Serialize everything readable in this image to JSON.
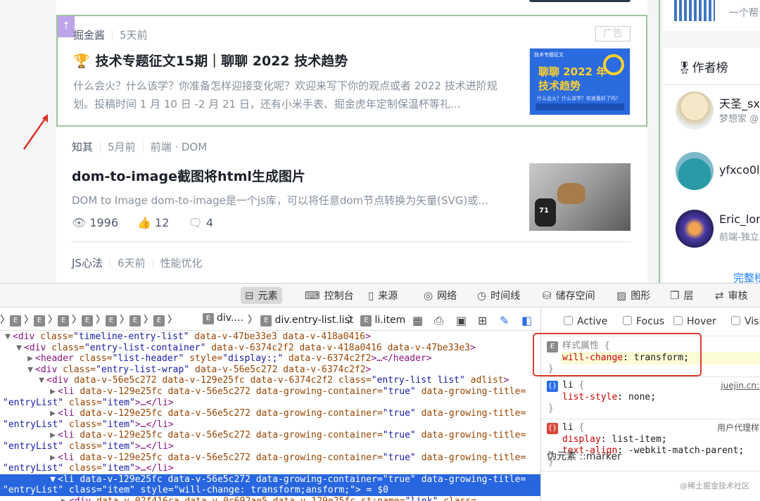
{
  "feed": {
    "ad_entry": {
      "corner_label": "↑",
      "author": "掘金酱",
      "time": "5天前",
      "badge": "广告",
      "title_icon": "trophy-icon",
      "title": "技术专题征文15期｜聊聊 2022 技术趋势",
      "abstract": "什么会火？什么该学？你准备怎样迎接变化呢？欢迎来写下你的观点或者 2022 技术进阶规划。投稿时间 1 月 10 日 -2 月 21 日，还有小米手表、掘金虎年定制保温杯等礼…",
      "thumb": {
        "top_text": "技术专题征文",
        "line1": "聊聊 2022 年",
        "line2": "技术趋势",
        "sub": "什么会火？什么该学？你准备好了吗？"
      }
    },
    "entry2": {
      "author": "知其",
      "time": "5月前",
      "tags": "前端 · DOM",
      "title": "dom-to-image截图将html生成图片",
      "abstract": "DOM to Image dom-to-image是一个js库，可以将任意dom节点转换为矢量(SVG)或…",
      "thumb_number": "71",
      "views": "1996",
      "likes": "12",
      "comments": "4"
    },
    "entry3": {
      "author": "JS心法",
      "time": "6天前",
      "tags": "性能优化"
    }
  },
  "sidebar": {
    "top_text": "一个帮",
    "authors_title": "作者榜",
    "authors": [
      {
        "name": "天圣_sx",
        "desc": "梦想家 @"
      },
      {
        "name": "yfxco0l",
        "desc": ""
      },
      {
        "name": "Eric_lor",
        "desc": "前端-独立"
      }
    ],
    "more": "完整榜"
  },
  "devtools": {
    "tabs": [
      {
        "icon": "elements-icon",
        "label": "元素"
      },
      {
        "icon": "console-icon",
        "label": "控制台"
      },
      {
        "icon": "sources-icon",
        "label": "来源"
      },
      {
        "icon": "network-icon",
        "label": "网络"
      },
      {
        "icon": "timeline-icon",
        "label": "时间线"
      },
      {
        "icon": "storage-icon",
        "label": "储存空间"
      },
      {
        "icon": "graphics-icon",
        "label": "图形"
      },
      {
        "icon": "layers-icon",
        "label": "层"
      },
      {
        "icon": "audit-icon",
        "label": "审核"
      }
    ],
    "breadcrumb": {
      "item1": "div....",
      "item2": "div.entry-list.list",
      "item3": "li.item"
    },
    "dom_lines": [
      {
        "tw": "▼",
        "indent": 0,
        "parts": [
          [
            "tg",
            "<div "
          ],
          [
            "an",
            "class="
          ],
          [
            "av",
            "\"timeline-entry-list\""
          ],
          [
            "an",
            " data-v-47be33e3 data-v-418a0416"
          ],
          [
            "tg",
            ">"
          ]
        ]
      },
      {
        "tw": "▼",
        "indent": 1,
        "parts": [
          [
            "tg",
            "<div "
          ],
          [
            "an",
            "class="
          ],
          [
            "av",
            "\"entry-list-container\""
          ],
          [
            "an",
            " data-v-6374c2f2 data-v-418a0416 data-v-47be33e3"
          ],
          [
            "tg",
            ">"
          ]
        ]
      },
      {
        "tw": "▶",
        "indent": 2,
        "parts": [
          [
            "tg",
            "<header "
          ],
          [
            "an",
            "class="
          ],
          [
            "av",
            "\"list-header\""
          ],
          [
            "an",
            " style="
          ],
          [
            "av",
            "\"display:;\""
          ],
          [
            "an",
            " data-v-6374c2f2"
          ],
          [
            "tg",
            ">…</header>"
          ]
        ]
      },
      {
        "tw": "▼",
        "indent": 2,
        "parts": [
          [
            "tg",
            "<div "
          ],
          [
            "an",
            "class="
          ],
          [
            "av",
            "\"entry-list-wrap\""
          ],
          [
            "an",
            " data-v-56e5c272 data-v-6374c2f2"
          ],
          [
            "tg",
            ">"
          ]
        ]
      },
      {
        "tw": "▼",
        "indent": 3,
        "parts": [
          [
            "tg",
            "<div "
          ],
          [
            "an",
            "data-v-56e5c272 data-v-129e25fc data-v-6374c2f2 class="
          ],
          [
            "av",
            "\"entry-list list\""
          ],
          [
            "an",
            " adlist"
          ],
          [
            "tg",
            ">"
          ]
        ]
      },
      {
        "tw": "▶",
        "indent": 4,
        "parts": [
          [
            "tg",
            "<li "
          ],
          [
            "an",
            "data-v-129e25fc data-v-56e5c272 data-growing-container="
          ],
          [
            "av",
            "\"true\""
          ],
          [
            "an",
            " data-growing-title="
          ]
        ]
      },
      {
        "tw": "",
        "indent": 0,
        "parts": [
          [
            "av",
            "\"entryList\""
          ],
          [
            "an",
            " class="
          ],
          [
            "av",
            "\"item\""
          ],
          [
            "tg",
            ">…</li>"
          ]
        ]
      },
      {
        "tw": "▶",
        "indent": 4,
        "parts": [
          [
            "tg",
            "<li "
          ],
          [
            "an",
            "data-v-129e25fc data-v-56e5c272 data-growing-container="
          ],
          [
            "av",
            "\"true\""
          ],
          [
            "an",
            " data-growing-title="
          ]
        ]
      },
      {
        "tw": "",
        "indent": 0,
        "parts": [
          [
            "av",
            "\"entryList\""
          ],
          [
            "an",
            " class="
          ],
          [
            "av",
            "\"item\""
          ],
          [
            "tg",
            ">…</li>"
          ]
        ]
      },
      {
        "tw": "▶",
        "indent": 4,
        "parts": [
          [
            "tg",
            "<li "
          ],
          [
            "an",
            "data-v-129e25fc data-v-56e5c272 data-growing-container="
          ],
          [
            "av",
            "\"true\""
          ],
          [
            "an",
            " data-growing-title="
          ]
        ]
      },
      {
        "tw": "",
        "indent": 0,
        "parts": [
          [
            "av",
            "\"entryList\""
          ],
          [
            "an",
            " class="
          ],
          [
            "av",
            "\"item\""
          ],
          [
            "tg",
            ">…</li>"
          ]
        ]
      },
      {
        "tw": "▶",
        "indent": 4,
        "parts": [
          [
            "tg",
            "<li "
          ],
          [
            "an",
            "data-v-129e25fc data-v-56e5c272 data-growing-container="
          ],
          [
            "av",
            "\"true\""
          ],
          [
            "an",
            " data-growing-title="
          ]
        ]
      },
      {
        "tw": "",
        "indent": 0,
        "parts": [
          [
            "av",
            "\"entryList\""
          ],
          [
            "an",
            " class="
          ],
          [
            "av",
            "\"item\""
          ],
          [
            "tg",
            ">…</li>"
          ]
        ]
      },
      {
        "tw": "▼",
        "indent": 4,
        "selected": true,
        "parts": [
          [
            "tg",
            "<li "
          ],
          [
            "an",
            "data-v-129e25fc data-v-56e5c272 data-growing-container="
          ],
          [
            "av",
            "\"true\""
          ],
          [
            "an",
            " data-growing-title="
          ]
        ]
      },
      {
        "tw": "",
        "indent": 0,
        "selected": true,
        "parts": [
          [
            "av",
            "\"entryList\""
          ],
          [
            "an",
            " class="
          ],
          [
            "av",
            "\"item\""
          ],
          [
            "an",
            " style="
          ],
          [
            "av",
            "\"will-change: transform;ansform;\""
          ],
          [
            "tg",
            ">"
          ],
          [
            "tx",
            " = $0"
          ]
        ]
      },
      {
        "tw": "▶",
        "indent": 5,
        "parts": [
          [
            "tg",
            "<div "
          ],
          [
            "an",
            "data-v-02f416ca data-v-0c692ae5 data-v-129e25fc st:name="
          ],
          [
            "av",
            "\"link\""
          ],
          [
            "an",
            " class="
          ]
        ]
      }
    ],
    "states": [
      "Active",
      "Focus",
      "Hover",
      "Visit"
    ],
    "rules": {
      "style_attr_title": "样式属性",
      "style_prop": "will-change",
      "style_val": "transform",
      "li1_selector": "li",
      "li1_source": "juejin.cn:",
      "li1_prop": "list-style",
      "li1_val": "none",
      "li2_selector": "li",
      "li2_source": "用户代理样",
      "li2_prop1": "display",
      "li2_val1": "list-item",
      "li2_prop2": "text-align",
      "li2_val2": "-webkit-match-parent"
    },
    "pseudo": "伪元素 ::marker",
    "watermark": "@稀土掘金技术社区"
  }
}
